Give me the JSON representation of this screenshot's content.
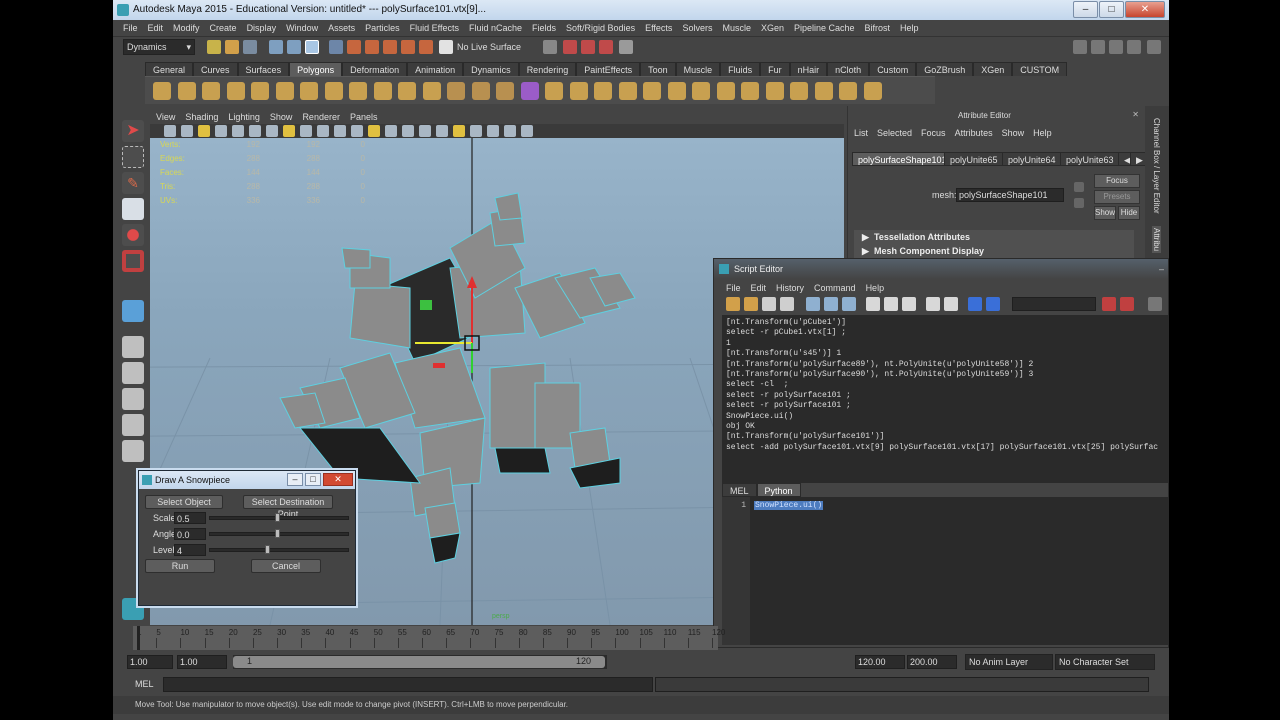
{
  "window": {
    "title": "Autodesk Maya 2015 - Educational Version: untitled*   ---   polySurface101.vtx[9]..."
  },
  "menubar": [
    "File",
    "Edit",
    "Modify",
    "Create",
    "Display",
    "Window",
    "Assets",
    "Particles",
    "Fluid Effects",
    "Fluid nCache",
    "Fields",
    "Soft/Rigid Bodies",
    "Effects",
    "Solvers",
    "Muscle",
    "XGen",
    "Pipeline Cache",
    "Bifrost",
    "Help"
  ],
  "statusline": {
    "menuset": "Dynamics",
    "live_surface": "No Live Surface"
  },
  "shelf_tabs": [
    "General",
    "Curves",
    "Surfaces",
    "Polygons",
    "Deformation",
    "Animation",
    "Dynamics",
    "Rendering",
    "PaintEffects",
    "Toon",
    "Muscle",
    "Fluids",
    "Fur",
    "nHair",
    "nCloth",
    "Custom",
    "GoZBrush",
    "XGen",
    "CUSTOM"
  ],
  "shelf_active": "Polygons",
  "viewport": {
    "menu": [
      "View",
      "Shading",
      "Lighting",
      "Show",
      "Renderer",
      "Panels"
    ],
    "hud_labels": [
      "Verts:",
      "Edges:",
      "Faces:",
      "Tris:",
      "UVs:"
    ],
    "hud_values": [
      [
        "192",
        "192",
        "0"
      ],
      [
        "288",
        "288",
        "0"
      ],
      [
        "144",
        "144",
        "0"
      ],
      [
        "288",
        "288",
        "0"
      ],
      [
        "336",
        "336",
        "0"
      ]
    ],
    "camera": "persp"
  },
  "attribute_editor": {
    "title": "Attribute Editor",
    "menu": [
      "List",
      "Selected",
      "Focus",
      "Attributes",
      "Show",
      "Help"
    ],
    "tabs": [
      "polySurfaceShape101",
      "polyUnite65",
      "polyUnite64",
      "polyUnite63"
    ],
    "mesh_label": "mesh:",
    "mesh_value": "polySurfaceShape101",
    "focus": "Focus",
    "presets": "Presets",
    "show": "Show",
    "hide": "Hide",
    "sections": [
      "Tessellation Attributes",
      "Mesh Component Display"
    ]
  },
  "side_strip": {
    "channel_box": "Channel Box / Layer Editor",
    "attribute": "Attribu"
  },
  "script_editor": {
    "title": "Script Editor",
    "menu": [
      "File",
      "Edit",
      "History",
      "Command",
      "Help"
    ],
    "history": [
      "[nt.Transform(u'pCube1')]",
      "select -r pCube1.vtx[1] ;",
      "1",
      "[nt.Transform(u's45')] 1",
      "[nt.Transform(u'polySurface89'), nt.PolyUnite(u'polyUnite58')] 2",
      "[nt.Transform(u'polySurface90'), nt.PolyUnite(u'polyUnite59')] 3",
      "select -cl  ;",
      "select -r polySurface101 ;",
      "select -r polySurface101 ;",
      "SnowPiece.ui()",
      "obj OK",
      "[nt.Transform(u'polySurface101')]",
      "select -add polySurface101.vtx[9] polySurface101.vtx[17] polySurface101.vtx[25] polySurfac"
    ],
    "tabs": [
      "MEL",
      "Python"
    ],
    "active_tab": "Python",
    "line_number": "1",
    "input": "SnowPiece.ui()"
  },
  "snow_dialog": {
    "title": "Draw A Snowpiece",
    "select_object": "Select Object",
    "select_destination": "Select Destination Point",
    "scale_label": "Scale",
    "scale_value": "0.5",
    "angle_label": "Angle",
    "angle_value": "0.0",
    "level_label": "Level",
    "level_value": "4",
    "run": "Run",
    "cancel": "Cancel",
    "scale_slider": 0.5,
    "angle_slider": 0.5,
    "level_slider": 0.43
  },
  "timeline": {
    "ticks": [
      "1",
      "5",
      "10",
      "15",
      "20",
      "25",
      "30",
      "35",
      "40",
      "45",
      "50",
      "55",
      "60",
      "65",
      "70",
      "75",
      "80",
      "85",
      "90",
      "95",
      "100",
      "105",
      "110",
      "115",
      "120"
    ],
    "start": 1,
    "end": 120
  },
  "range": {
    "start": "1.00",
    "min": "1.00",
    "slider_start": "1",
    "slider_end": "120",
    "end": "120.00",
    "max": "200.00",
    "anim_layer": "No Anim Layer",
    "char_set": "No Character Set"
  },
  "command_line": {
    "label": "MEL"
  },
  "help_line": "Move Tool: Use manipulator to move object(s). Use edit mode to change pivot (INSERT). Ctrl+LMB to move perpendicular."
}
